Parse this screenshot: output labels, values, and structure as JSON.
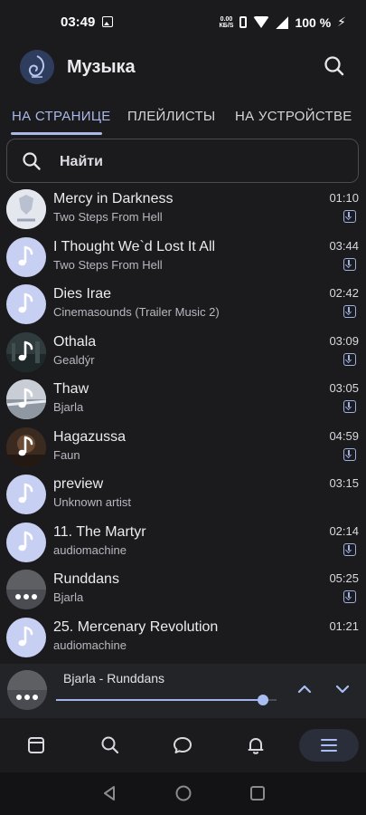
{
  "status": {
    "time": "03:49",
    "speed": "0.00",
    "speed_unit": "КБ/S",
    "battery": "100 %"
  },
  "header": {
    "title": "Музыка"
  },
  "tabs": [
    {
      "label": "НА СТРАНИЦЕ",
      "active": true
    },
    {
      "label": "ПЛЕЙЛИСТЫ",
      "active": false
    },
    {
      "label": "НА УСТРОЙСТВЕ",
      "active": false
    }
  ],
  "search": {
    "placeholder": "Найти"
  },
  "tracks": [
    {
      "title": "Mercy in Darkness",
      "artist": "Two Steps From Hell",
      "duration": "01:10",
      "downloadable": true
    },
    {
      "title": "I Thought We`d Lost It All",
      "artist": "Two Steps From Hell",
      "duration": "03:44",
      "downloadable": true
    },
    {
      "title": "Dies Irae",
      "artist": "Cinemasounds (Trailer Music 2)",
      "duration": "02:42",
      "downloadable": true
    },
    {
      "title": "Othala",
      "artist": "Gealdýr",
      "duration": "03:09",
      "downloadable": true
    },
    {
      "title": "Thaw",
      "artist": "Bjarla",
      "duration": "03:05",
      "downloadable": true
    },
    {
      "title": "Hagazussa",
      "artist": "Faun",
      "duration": "04:59",
      "downloadable": true
    },
    {
      "title": "preview",
      "artist": "Unknown artist",
      "duration": "03:15",
      "downloadable": false
    },
    {
      "title": "11. The Martyr",
      "artist": "audiomachine",
      "duration": "02:14",
      "downloadable": true
    },
    {
      "title": "Runddans",
      "artist": "Bjarla",
      "duration": "05:25",
      "downloadable": true
    },
    {
      "title": "25. Mercenary Revolution",
      "artist": "audiomachine",
      "duration": "01:21",
      "downloadable": false
    }
  ],
  "player": {
    "now_playing": "Bjarla - Runddans",
    "progress": 0.94
  },
  "colors": {
    "accent": "#a9b8e8",
    "background": "#1b1b1e",
    "cover_placeholder": "#c7d0f2"
  }
}
